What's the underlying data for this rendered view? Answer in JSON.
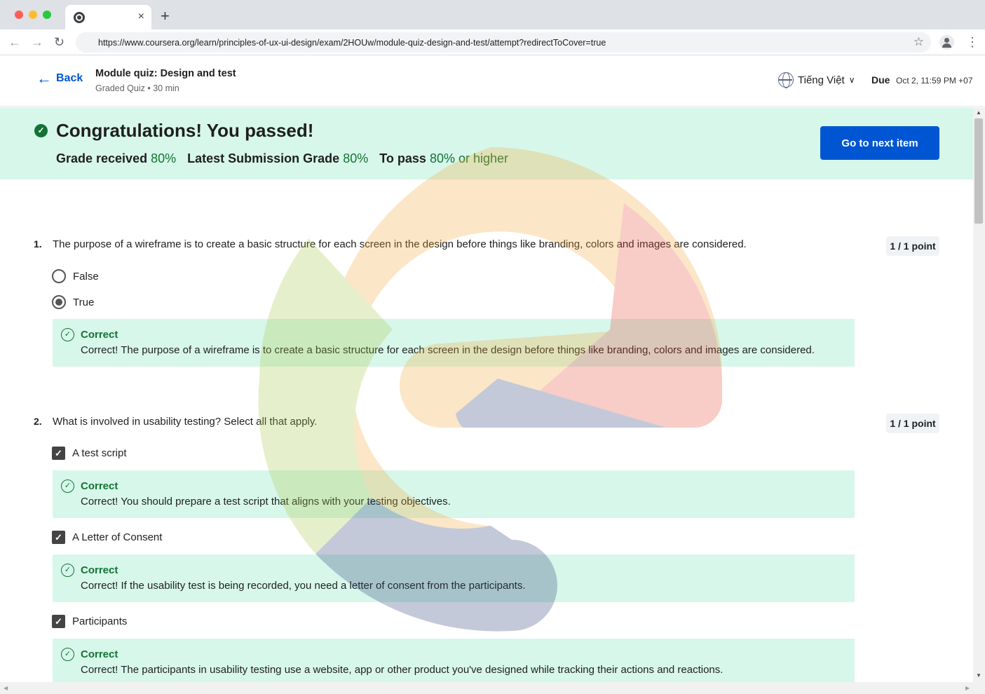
{
  "browser": {
    "tab_close": "×",
    "new_tab": "+",
    "url": "https://www.coursera.org/learn/principles-of-ux-ui-design/exam/2HOUw/module-quiz-design-and-test/attempt?redirectToCover=true",
    "icons": [
      "chrome-icon",
      "back-arrow-icon",
      "forward-arrow-icon",
      "reload-icon",
      "star-icon",
      "profile-icon",
      "kebab-menu-icon"
    ]
  },
  "header": {
    "back_label": "Back",
    "title": "Module quiz: Design and test",
    "subtitle": "Graded Quiz • 30 min",
    "language": "Tiếng Việt",
    "due_label": "Due",
    "due_date": "Oct 2, 11:59 PM +07"
  },
  "banner": {
    "title": "Congratulations! You passed!",
    "grade_received_label": "Grade received",
    "grade_received_value": "80%",
    "latest_label": "Latest Submission Grade",
    "latest_value": "80%",
    "to_pass_label": "To pass",
    "to_pass_value": "80% or higher",
    "next_button": "Go to next item",
    "accent": "#0056d2",
    "success": "#137333"
  },
  "questions": [
    {
      "number": "1.",
      "text": "The purpose of a wireframe is to create a basic structure for each screen in the design before things like branding, colors and images are considered.",
      "points": "1 / 1 point",
      "options": [
        {
          "label": "False",
          "selected": false
        },
        {
          "label": "True",
          "selected": true
        }
      ],
      "feedback": [
        {
          "title": "Correct",
          "text": "Correct! The purpose of a wireframe is to create a basic structure for each screen in the design before things like branding, colors and images are considered."
        }
      ]
    },
    {
      "number": "2.",
      "text": "What is involved in usability testing? Select all that apply.",
      "points": "1 / 1 point",
      "options": [
        {
          "label": "A test script",
          "checked": true,
          "feedback_title": "Correct",
          "feedback_text": "Correct! You should prepare a test script that aligns with your testing objectives."
        },
        {
          "label": "A Letter of Consent",
          "checked": true,
          "feedback_title": "Correct",
          "feedback_text": "Correct! If the usability test is being recorded, you need a letter of consent from the participants."
        },
        {
          "label": "Participants",
          "checked": true,
          "feedback_title": "Correct",
          "feedback_text": "Correct! The participants in usability testing use a website, app or other product you've designed while tracking their actions and reactions."
        }
      ]
    }
  ]
}
